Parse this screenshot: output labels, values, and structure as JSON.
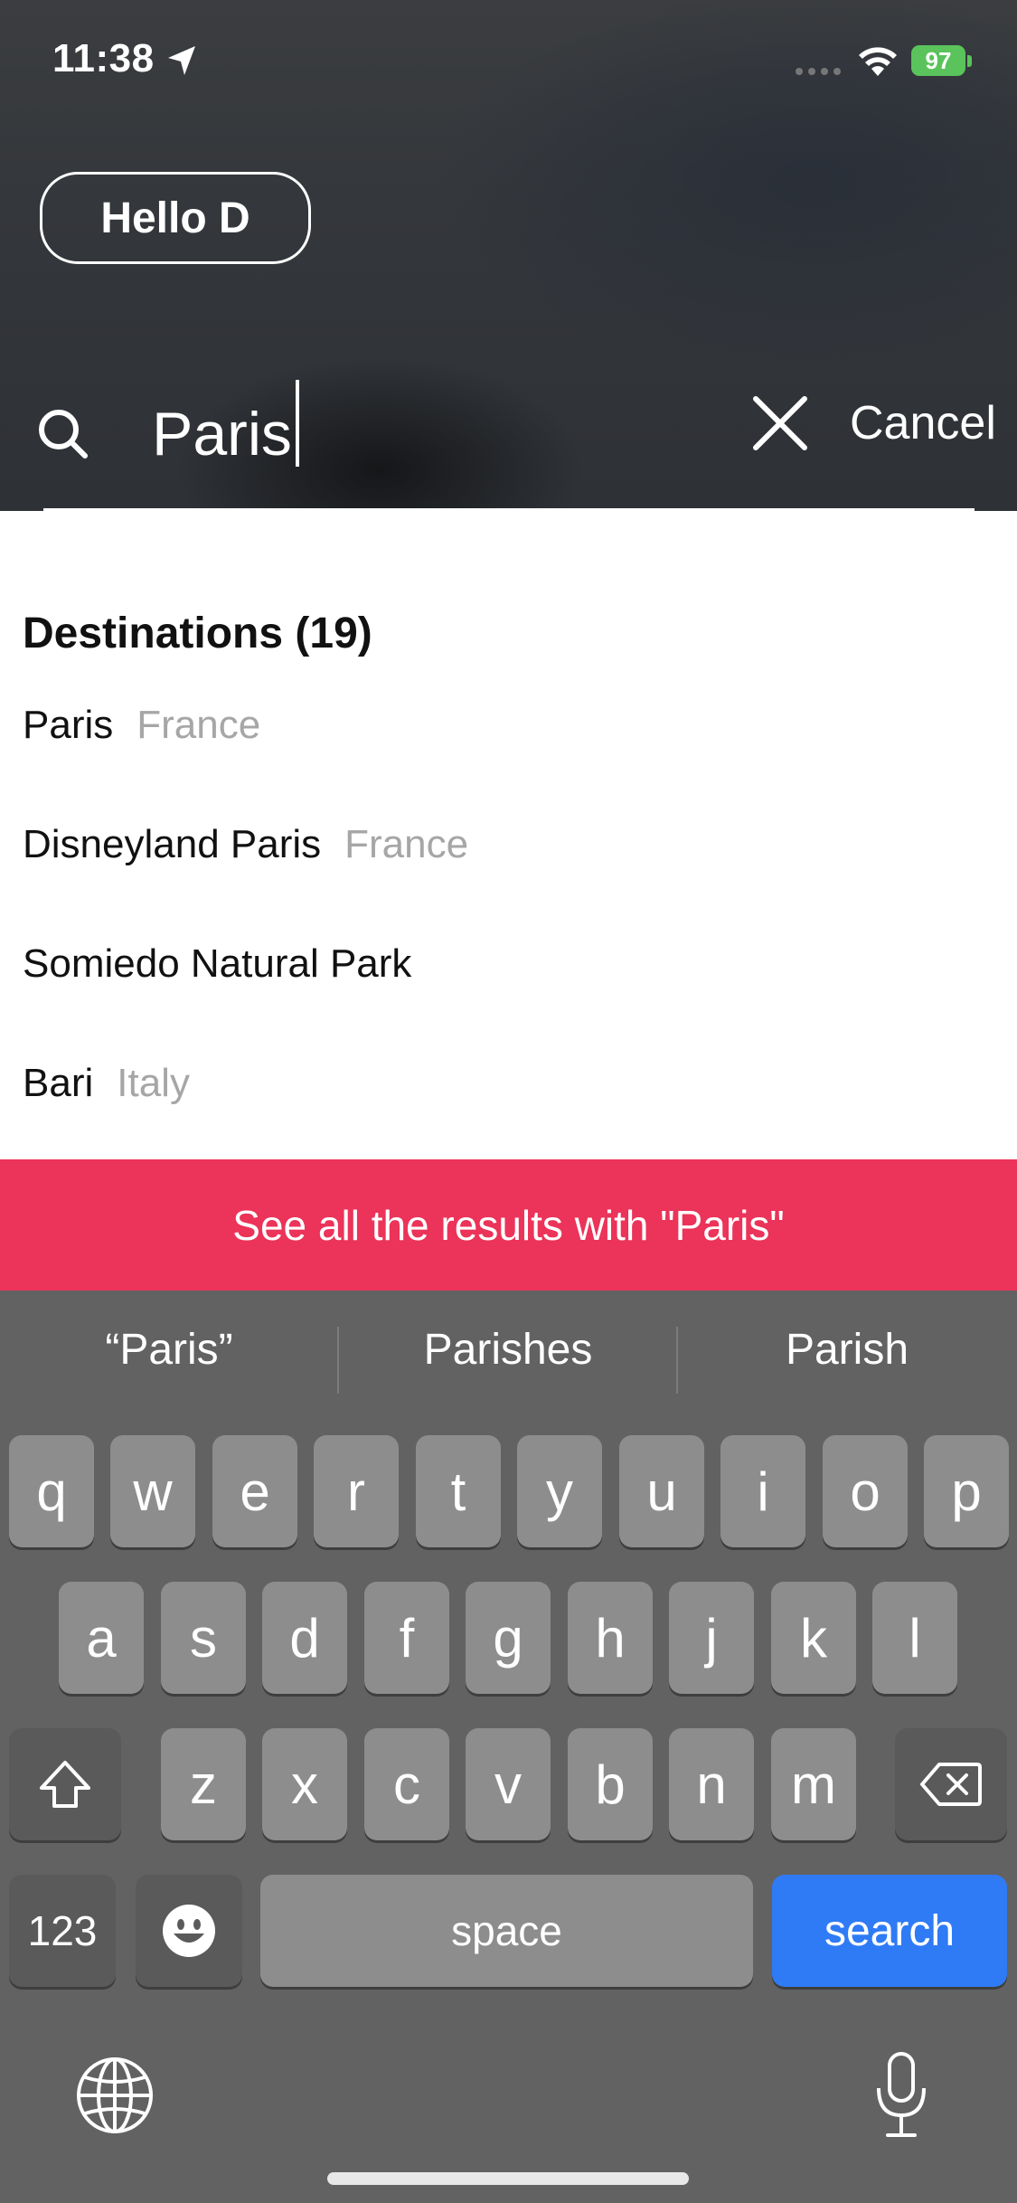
{
  "status_bar": {
    "time": "11:38",
    "battery": "97"
  },
  "header": {
    "greeting": "Hello D",
    "search": {
      "value": "Paris",
      "placeholder": ""
    },
    "cancel_label": "Cancel"
  },
  "results": {
    "section_title": "Destinations (19)",
    "items": [
      {
        "name": "Paris",
        "country": "France"
      },
      {
        "name": "Disneyland Paris",
        "country": "France"
      },
      {
        "name": "Somiedo Natural Park",
        "country": ""
      },
      {
        "name": "Bari",
        "country": "Italy"
      }
    ],
    "see_all_label": "See all the results with \"Paris\""
  },
  "keyboard": {
    "suggestions": [
      "“Paris”",
      "Parishes",
      "Parish"
    ],
    "row1": [
      "q",
      "w",
      "e",
      "r",
      "t",
      "y",
      "u",
      "i",
      "o",
      "p"
    ],
    "row2": [
      "a",
      "s",
      "d",
      "f",
      "g",
      "h",
      "j",
      "k",
      "l"
    ],
    "row3": [
      "z",
      "x",
      "c",
      "v",
      "b",
      "n",
      "m"
    ],
    "numbers_label": "123",
    "space_label": "space",
    "search_label": "search"
  },
  "colors": {
    "accent": "#ec3359",
    "search_key": "#2f7bf5",
    "battery": "#5ac35b"
  }
}
